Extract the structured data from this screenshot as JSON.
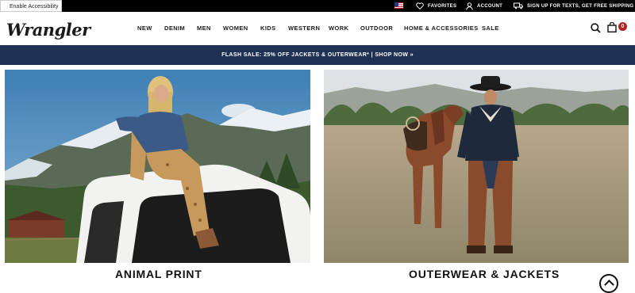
{
  "topbar": {
    "accessibility_label": "Enable Accessibility",
    "favorites_label": "FAVORITES",
    "account_label": "ACCOUNT",
    "texts_label": "SIGN UP FOR TEXTS, GET FREE SHIPPING"
  },
  "header": {
    "logo": "Wrangler",
    "nav": [
      "NEW",
      "DENIM",
      "MEN",
      "WOMEN",
      "KIDS",
      "WESTERN",
      "WORK",
      "OUTDOOR",
      "HOME & ACCESSORIES",
      "SALE"
    ],
    "cart_count": "0"
  },
  "promo": {
    "text": "FLASH SALE: 25% OFF JACKETS & OUTERWEAR* | SHOP NOW »"
  },
  "tiles": [
    {
      "caption": "ANIMAL PRINT"
    },
    {
      "caption": "OUTERWEAR & JACKETS"
    }
  ],
  "colors": {
    "promo_bg": "#1f3256",
    "topbar_bg": "#000000",
    "cart_badge": "#b22222"
  }
}
